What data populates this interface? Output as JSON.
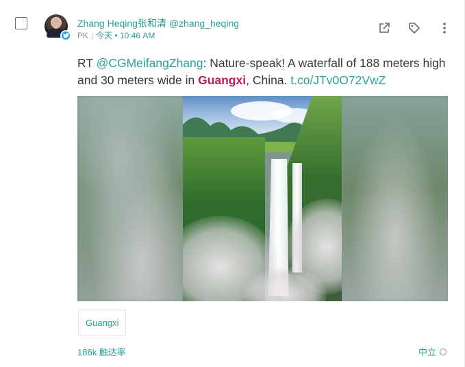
{
  "post": {
    "author_name": "Zhang Heqing张和清",
    "author_handle": "@zhang_heqing",
    "source_label": "PK",
    "timestamp": "今天 • 10:46 AM",
    "text": {
      "prefix": "RT ",
      "mention": "@CGMeifangZhang",
      "body_1": ": Nature-speak! A waterfall of 188 meters high and 30 meters wide in ",
      "hashtag": "Guangxi",
      "body_2": ", China. ",
      "link": "t.co/JTv0O72VwZ"
    },
    "media_icon": "waterfall-photo",
    "tag": "Guangxi",
    "reach": "186k 触达率",
    "sentiment": "中立"
  },
  "actions": {
    "open_icon": "open-external-icon",
    "tag_icon": "tag-icon",
    "more_icon": "more-vertical-icon"
  },
  "colors": {
    "accent": "#2aa198",
    "hashtag": "#c2185b",
    "twitter": "#1da1f2"
  }
}
